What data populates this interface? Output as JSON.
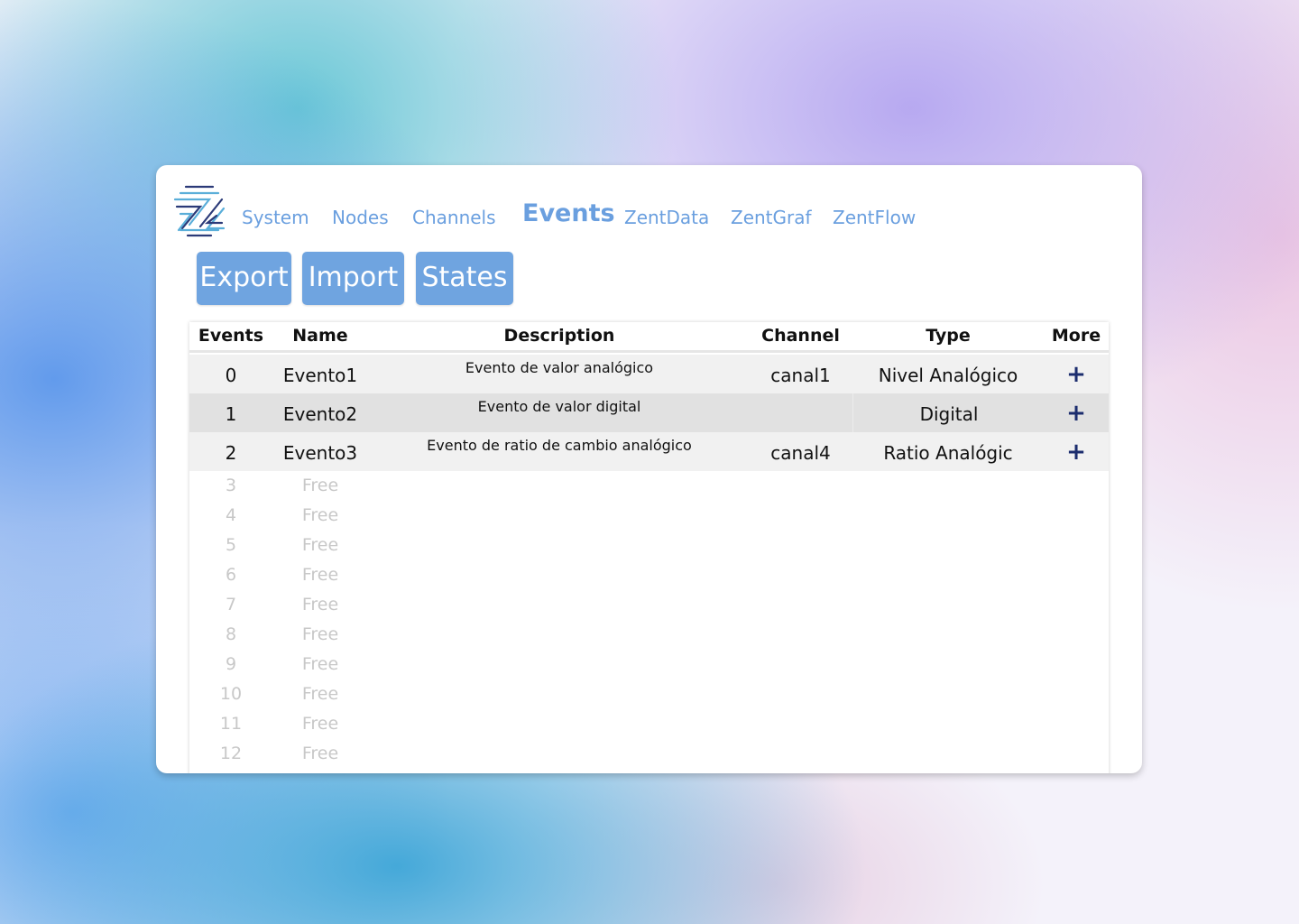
{
  "nav": {
    "items": [
      "System",
      "Nodes",
      "Channels",
      "Events",
      "ZentData",
      "ZentGraf",
      "ZentFlow"
    ],
    "active": "Events"
  },
  "logo": {
    "icon": "zent-logo-icon",
    "colors": [
      "#5aaed9",
      "#2b3a78"
    ]
  },
  "toolbar": {
    "export_label": "Export",
    "import_label": "Import",
    "states_label": "States"
  },
  "table": {
    "columns": [
      "Events",
      "Name",
      "Description",
      "Channel",
      "Type",
      "More"
    ],
    "rows": [
      {
        "id": "0",
        "name": "Evento1",
        "description": "Evento de valor analógico",
        "channel": "canal1",
        "type": "Nivel Analógico",
        "more": "+"
      },
      {
        "id": "1",
        "name": "Evento2",
        "description": "Evento de valor digital",
        "channel": "",
        "type": "Digital",
        "more": "+"
      },
      {
        "id": "2",
        "name": "Evento3",
        "description": "Evento de ratio de cambio analógico",
        "channel": "canal4",
        "type": "Ratio Analógic",
        "more": "+"
      }
    ],
    "free_rows": [
      {
        "id": "3",
        "name": "Free"
      },
      {
        "id": "4",
        "name": "Free"
      },
      {
        "id": "5",
        "name": "Free"
      },
      {
        "id": "6",
        "name": "Free"
      },
      {
        "id": "7",
        "name": "Free"
      },
      {
        "id": "8",
        "name": "Free"
      },
      {
        "id": "9",
        "name": "Free"
      },
      {
        "id": "10",
        "name": "Free"
      },
      {
        "id": "11",
        "name": "Free"
      },
      {
        "id": "12",
        "name": "Free"
      }
    ]
  },
  "colors": {
    "accent": "#6fa4e0",
    "nav_text": "#6a9fdf",
    "plus_icon": "#1c2d6e",
    "row_even": "#f1f1f1",
    "row_odd": "#e1e1e1",
    "free_text": "#c8c8c8"
  }
}
